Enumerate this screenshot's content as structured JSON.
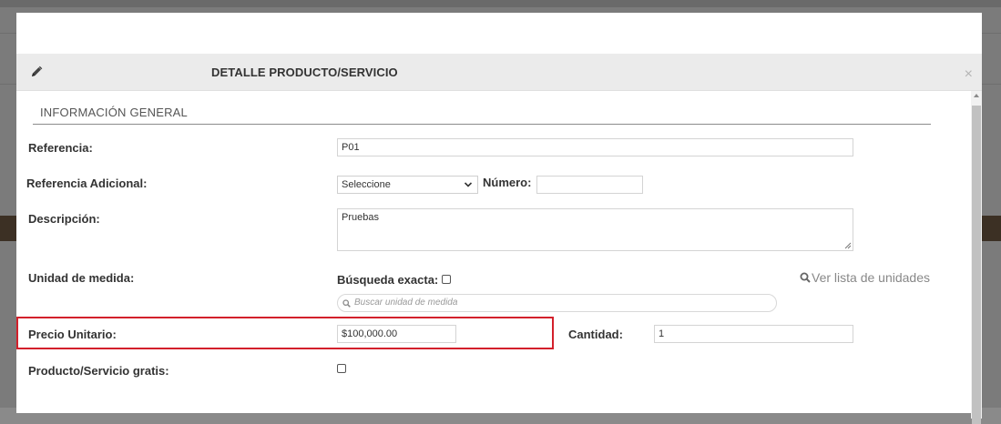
{
  "modal": {
    "title": "DETALLE PRODUCTO/SERVICIO",
    "close_label": "×",
    "section_title": "INFORMACIÓN GENERAL"
  },
  "form": {
    "referencia": {
      "label": "Referencia:",
      "value": "P01"
    },
    "referencia_adicional": {
      "label": "Referencia Adicional:",
      "selected": "Seleccione"
    },
    "numero": {
      "label": "Número:",
      "value": ""
    },
    "descripcion": {
      "label": "Descripción:",
      "value": "Pruebas"
    },
    "unidad_medida": {
      "label": "Unidad de medida:",
      "busqueda_exacta_label": "Búsqueda exacta:",
      "search_placeholder": "Buscar unidad de medida",
      "ver_lista_label": "Ver lista de unidades"
    },
    "precio_unitario": {
      "label": "Precio Unitario:",
      "value": "$100,000.00"
    },
    "cantidad": {
      "label": "Cantidad:",
      "value": "1"
    },
    "gratis": {
      "label": "Producto/Servicio gratis:"
    }
  },
  "colors": {
    "highlight": "#d3202b",
    "header_bg": "#ebebeb",
    "overlay": "#7b7b7b"
  },
  "icons": [
    "pencil-icon",
    "close-icon",
    "chevron-down-icon",
    "search-icon"
  ]
}
